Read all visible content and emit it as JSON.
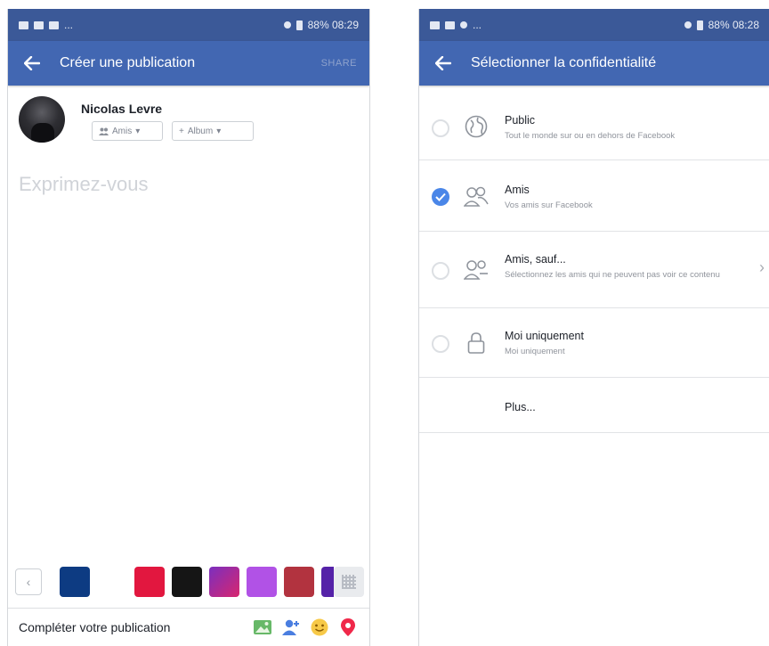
{
  "left": {
    "status": {
      "left_text": "...",
      "right_text": "88% 08:29"
    },
    "appbar": {
      "title": "Créer une publication",
      "action": "SHARE"
    },
    "author": "Nicolas Levre",
    "audience_pill": "Amis",
    "album_pill": "Album",
    "composer_placeholder": "Exprimez-vous",
    "swatch_colors": [
      "#0d3b82",
      "#ffffff",
      "#e2173f",
      "#151515",
      "#a328b5",
      "#b152e6",
      "#b2333f",
      "#5522a8"
    ],
    "footer_label": "Compléter votre publication",
    "tools": [
      "photo-icon",
      "tag-people-icon",
      "feeling-icon",
      "location-icon"
    ]
  },
  "right": {
    "status": {
      "left_text": "...",
      "right_text": "88% 08:28"
    },
    "appbar": {
      "title": "Sélectionner la confidentialité"
    },
    "options": [
      {
        "title": "Public",
        "subtitle": "Tout le monde sur ou en dehors de Facebook",
        "icon": "globe-icon",
        "selected": false
      },
      {
        "title": "Amis",
        "subtitle": "Vos amis sur Facebook",
        "icon": "friends-icon",
        "selected": true
      },
      {
        "title": "Amis, sauf...",
        "subtitle": "Sélectionnez les amis qui ne peuvent pas voir ce contenu",
        "icon": "friends-except-icon",
        "selected": false
      },
      {
        "title": "Moi uniquement",
        "subtitle": "Moi uniquement",
        "icon": "lock-icon",
        "selected": false
      }
    ],
    "more_label": "Plus..."
  },
  "colors": {
    "status_bar": "#3b5998",
    "app_bar": "#4267b2",
    "checked": "#4a86e8"
  }
}
